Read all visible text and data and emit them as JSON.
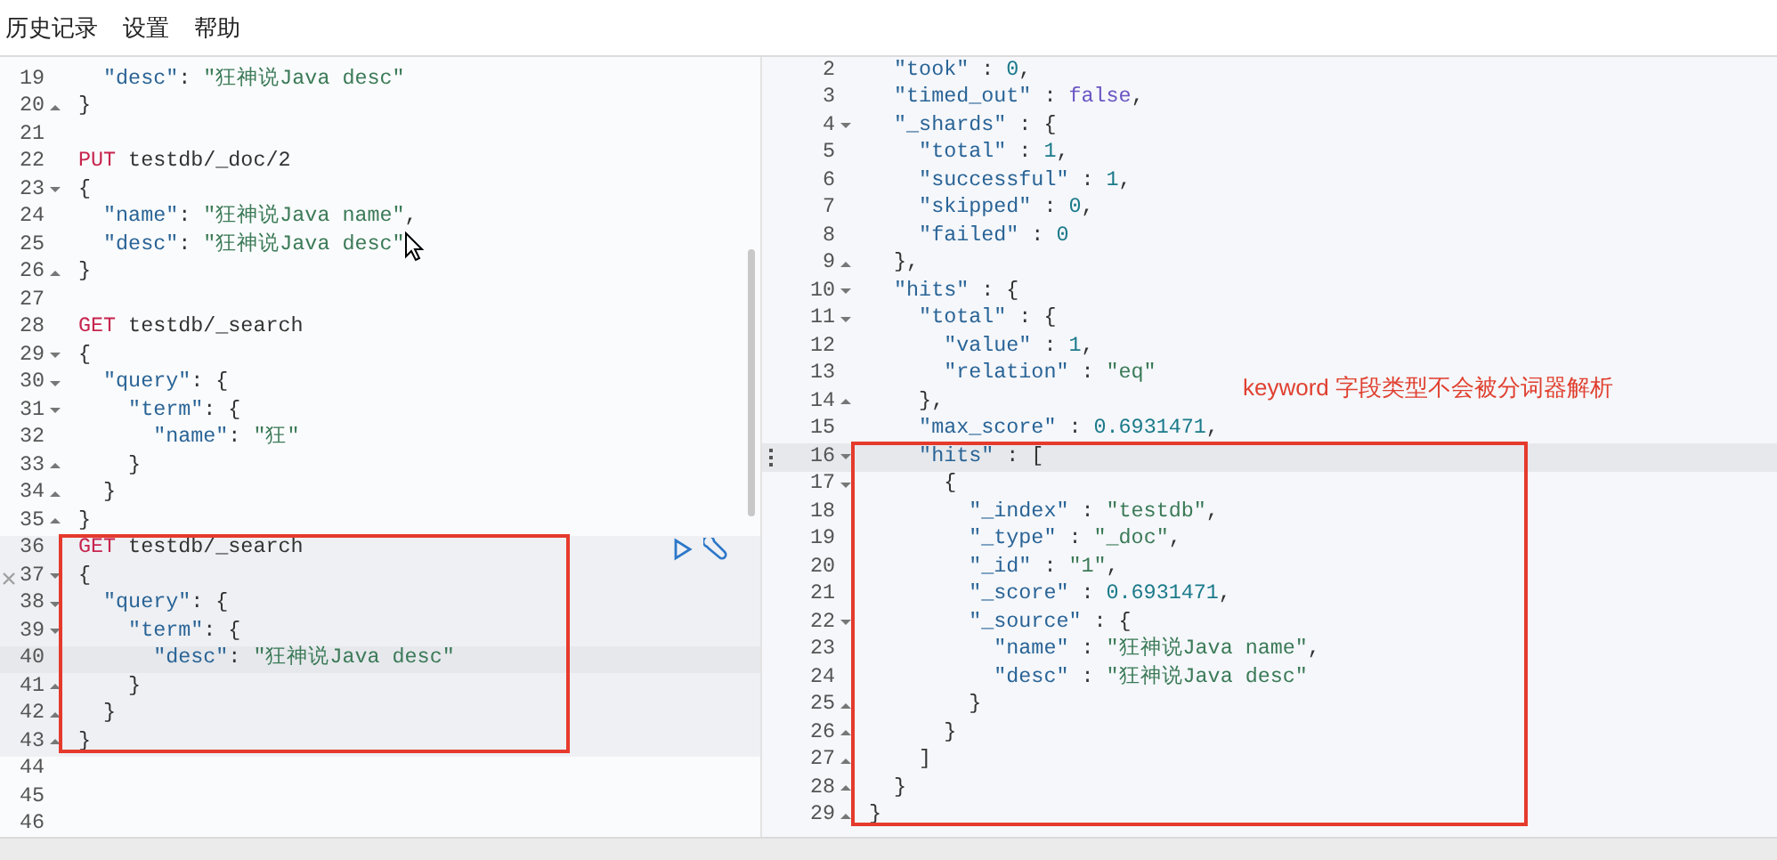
{
  "menu": [
    {
      "label": "历史记录"
    },
    {
      "label": "设置"
    },
    {
      "label": "帮助"
    }
  ],
  "left": {
    "lines": [
      {
        "num": "19",
        "fold_start": false,
        "fold_end": false,
        "active": false,
        "in_block": false,
        "boxed": false,
        "tokens": [
          {
            "kind": "key",
            "text": "  \"desc\""
          },
          {
            "kind": "punct",
            "text": ": "
          },
          {
            "kind": "string",
            "text": "\"狂神说Java desc\""
          }
        ]
      },
      {
        "num": "20",
        "fold_start": false,
        "fold_end": true,
        "active": false,
        "in_block": false,
        "boxed": false,
        "tokens": [
          {
            "kind": "punct",
            "text": "}"
          }
        ]
      },
      {
        "num": "21",
        "fold_start": false,
        "fold_end": false,
        "active": false,
        "in_block": false,
        "boxed": false
      },
      {
        "num": "22",
        "fold_start": false,
        "fold_end": false,
        "active": false,
        "in_block": false,
        "boxed": false,
        "tokens": [
          {
            "kind": "method",
            "text": "PUT"
          },
          {
            "kind": "url",
            "text": " testdb/_doc/2"
          }
        ]
      },
      {
        "num": "23",
        "fold_start": true,
        "fold_end": false,
        "active": false,
        "in_block": false,
        "boxed": false,
        "tokens": [
          {
            "kind": "punct",
            "text": "{"
          }
        ]
      },
      {
        "num": "24",
        "fold_start": false,
        "fold_end": false,
        "active": false,
        "in_block": false,
        "boxed": false,
        "tokens": [
          {
            "kind": "key",
            "text": "  \"name\""
          },
          {
            "kind": "punct",
            "text": ": "
          },
          {
            "kind": "string",
            "text": "\"狂神说Java name\""
          },
          {
            "kind": "punct",
            "text": ","
          }
        ]
      },
      {
        "num": "25",
        "fold_start": false,
        "fold_end": false,
        "active": false,
        "in_block": false,
        "boxed": false,
        "tokens": [
          {
            "kind": "key",
            "text": "  \"desc\""
          },
          {
            "kind": "punct",
            "text": ": "
          },
          {
            "kind": "string",
            "text": "\"狂神说Java desc\""
          }
        ]
      },
      {
        "num": "26",
        "fold_start": false,
        "fold_end": true,
        "active": false,
        "in_block": false,
        "boxed": false,
        "tokens": [
          {
            "kind": "punct",
            "text": "}"
          }
        ]
      },
      {
        "num": "27",
        "fold_start": false,
        "fold_end": false,
        "active": false,
        "in_block": false,
        "boxed": false
      },
      {
        "num": "28",
        "fold_start": false,
        "fold_end": false,
        "active": false,
        "in_block": false,
        "boxed": false,
        "tokens": [
          {
            "kind": "method",
            "text": "GET"
          },
          {
            "kind": "url",
            "text": " testdb/_search"
          }
        ]
      },
      {
        "num": "29",
        "fold_start": true,
        "fold_end": false,
        "active": false,
        "in_block": false,
        "boxed": false,
        "tokens": [
          {
            "kind": "punct",
            "text": "{"
          }
        ]
      },
      {
        "num": "30",
        "fold_start": true,
        "fold_end": false,
        "active": false,
        "in_block": false,
        "boxed": false,
        "tokens": [
          {
            "kind": "key",
            "text": "  \"query\""
          },
          {
            "kind": "punct",
            "text": ": {"
          }
        ]
      },
      {
        "num": "31",
        "fold_start": true,
        "fold_end": false,
        "active": false,
        "in_block": false,
        "boxed": false,
        "tokens": [
          {
            "kind": "key",
            "text": "    \"term\""
          },
          {
            "kind": "punct",
            "text": ": {"
          }
        ]
      },
      {
        "num": "32",
        "fold_start": false,
        "fold_end": false,
        "active": false,
        "in_block": false,
        "boxed": false,
        "tokens": [
          {
            "kind": "key",
            "text": "      \"name\""
          },
          {
            "kind": "punct",
            "text": ": "
          },
          {
            "kind": "string",
            "text": "\"狂\""
          }
        ]
      },
      {
        "num": "33",
        "fold_start": false,
        "fold_end": true,
        "active": false,
        "in_block": false,
        "boxed": false,
        "tokens": [
          {
            "kind": "punct",
            "text": "    }"
          }
        ]
      },
      {
        "num": "34",
        "fold_start": false,
        "fold_end": true,
        "active": false,
        "in_block": false,
        "boxed": false,
        "tokens": [
          {
            "kind": "punct",
            "text": "  }"
          }
        ]
      },
      {
        "num": "35",
        "fold_start": false,
        "fold_end": true,
        "active": false,
        "in_block": false,
        "boxed": false,
        "tokens": [
          {
            "kind": "punct",
            "text": "}"
          }
        ]
      },
      {
        "num": "36",
        "fold_start": false,
        "fold_end": false,
        "active": false,
        "in_block": true,
        "boxed": true,
        "tokens": [
          {
            "kind": "method",
            "text": "GET"
          },
          {
            "kind": "url",
            "text": " testdb/_search"
          }
        ]
      },
      {
        "num": "37",
        "fold_start": true,
        "fold_end": false,
        "active": false,
        "in_block": true,
        "boxed": true,
        "tokens": [
          {
            "kind": "punct",
            "text": "{"
          }
        ]
      },
      {
        "num": "38",
        "fold_start": true,
        "fold_end": false,
        "active": false,
        "in_block": true,
        "boxed": true,
        "tokens": [
          {
            "kind": "key",
            "text": "  \"query\""
          },
          {
            "kind": "punct",
            "text": ": {"
          }
        ]
      },
      {
        "num": "39",
        "fold_start": true,
        "fold_end": false,
        "active": false,
        "in_block": true,
        "boxed": true,
        "tokens": [
          {
            "kind": "key",
            "text": "    \"term\""
          },
          {
            "kind": "punct",
            "text": ": {"
          }
        ]
      },
      {
        "num": "40",
        "fold_start": false,
        "fold_end": false,
        "active": true,
        "in_block": true,
        "boxed": true,
        "tokens": [
          {
            "kind": "key",
            "text": "      \"desc\""
          },
          {
            "kind": "punct",
            "text": ": "
          },
          {
            "kind": "string",
            "text": "\"狂神说Java desc\""
          }
        ]
      },
      {
        "num": "41",
        "fold_start": false,
        "fold_end": true,
        "active": false,
        "in_block": true,
        "boxed": true,
        "tokens": [
          {
            "kind": "punct",
            "text": "    }"
          }
        ]
      },
      {
        "num": "42",
        "fold_start": false,
        "fold_end": true,
        "active": false,
        "in_block": true,
        "boxed": true,
        "tokens": [
          {
            "kind": "punct",
            "text": "  }"
          }
        ]
      },
      {
        "num": "43",
        "fold_start": false,
        "fold_end": true,
        "active": false,
        "in_block": true,
        "boxed": true,
        "tokens": [
          {
            "kind": "punct",
            "text": "}"
          }
        ]
      },
      {
        "num": "44",
        "fold_start": false,
        "fold_end": false,
        "active": false,
        "in_block": false,
        "boxed": false
      },
      {
        "num": "45",
        "fold_start": false,
        "fold_end": false,
        "active": false,
        "in_block": false,
        "boxed": false
      },
      {
        "num": "46",
        "fold_start": false,
        "fold_end": false,
        "active": false,
        "in_block": false,
        "boxed": false
      }
    ]
  },
  "right": {
    "lines": [
      {
        "num": "2",
        "fold_start": false,
        "fold_end": false,
        "active": false,
        "boxed": false,
        "tokens": [
          {
            "kind": "key",
            "text": "  \"took\""
          },
          {
            "kind": "punct",
            "text": " : "
          },
          {
            "kind": "number",
            "text": "0"
          },
          {
            "kind": "punct",
            "text": ","
          }
        ]
      },
      {
        "num": "3",
        "fold_start": false,
        "fold_end": false,
        "active": false,
        "boxed": false,
        "tokens": [
          {
            "kind": "key",
            "text": "  \"timed_out\""
          },
          {
            "kind": "punct",
            "text": " : "
          },
          {
            "kind": "bool",
            "text": "false"
          },
          {
            "kind": "punct",
            "text": ","
          }
        ]
      },
      {
        "num": "4",
        "fold_start": true,
        "fold_end": false,
        "active": false,
        "boxed": false,
        "tokens": [
          {
            "kind": "key",
            "text": "  \"_shards\""
          },
          {
            "kind": "punct",
            "text": " : {"
          }
        ]
      },
      {
        "num": "5",
        "fold_start": false,
        "fold_end": false,
        "active": false,
        "boxed": false,
        "tokens": [
          {
            "kind": "key",
            "text": "    \"total\""
          },
          {
            "kind": "punct",
            "text": " : "
          },
          {
            "kind": "number",
            "text": "1"
          },
          {
            "kind": "punct",
            "text": ","
          }
        ]
      },
      {
        "num": "6",
        "fold_start": false,
        "fold_end": false,
        "active": false,
        "boxed": false,
        "tokens": [
          {
            "kind": "key",
            "text": "    \"successful\""
          },
          {
            "kind": "punct",
            "text": " : "
          },
          {
            "kind": "number",
            "text": "1"
          },
          {
            "kind": "punct",
            "text": ","
          }
        ]
      },
      {
        "num": "7",
        "fold_start": false,
        "fold_end": false,
        "active": false,
        "boxed": false,
        "tokens": [
          {
            "kind": "key",
            "text": "    \"skipped\""
          },
          {
            "kind": "punct",
            "text": " : "
          },
          {
            "kind": "number",
            "text": "0"
          },
          {
            "kind": "punct",
            "text": ","
          }
        ]
      },
      {
        "num": "8",
        "fold_start": false,
        "fold_end": false,
        "active": false,
        "boxed": false,
        "tokens": [
          {
            "kind": "key",
            "text": "    \"failed\""
          },
          {
            "kind": "punct",
            "text": " : "
          },
          {
            "kind": "number",
            "text": "0"
          }
        ]
      },
      {
        "num": "9",
        "fold_start": false,
        "fold_end": true,
        "active": false,
        "boxed": false,
        "tokens": [
          {
            "kind": "punct",
            "text": "  },"
          }
        ]
      },
      {
        "num": "10",
        "fold_start": true,
        "fold_end": false,
        "active": false,
        "boxed": false,
        "tokens": [
          {
            "kind": "key",
            "text": "  \"hits\""
          },
          {
            "kind": "punct",
            "text": " : {"
          }
        ]
      },
      {
        "num": "11",
        "fold_start": true,
        "fold_end": false,
        "active": false,
        "boxed": false,
        "tokens": [
          {
            "kind": "key",
            "text": "    \"total\""
          },
          {
            "kind": "punct",
            "text": " : {"
          }
        ]
      },
      {
        "num": "12",
        "fold_start": false,
        "fold_end": false,
        "active": false,
        "boxed": false,
        "tokens": [
          {
            "kind": "key",
            "text": "      \"value\""
          },
          {
            "kind": "punct",
            "text": " : "
          },
          {
            "kind": "number",
            "text": "1"
          },
          {
            "kind": "punct",
            "text": ","
          }
        ]
      },
      {
        "num": "13",
        "fold_start": false,
        "fold_end": false,
        "active": false,
        "boxed": false,
        "tokens": [
          {
            "kind": "key",
            "text": "      \"relation\""
          },
          {
            "kind": "punct",
            "text": " : "
          },
          {
            "kind": "string",
            "text": "\"eq\""
          }
        ]
      },
      {
        "num": "14",
        "fold_start": false,
        "fold_end": true,
        "active": false,
        "boxed": false,
        "tokens": [
          {
            "kind": "punct",
            "text": "    },"
          }
        ]
      },
      {
        "num": "15",
        "fold_start": false,
        "fold_end": false,
        "active": false,
        "boxed": false,
        "tokens": [
          {
            "kind": "key",
            "text": "    \"max_score\""
          },
          {
            "kind": "punct",
            "text": " : "
          },
          {
            "kind": "number",
            "text": "0.6931471"
          },
          {
            "kind": "punct",
            "text": ","
          }
        ]
      },
      {
        "num": "16",
        "fold_start": true,
        "fold_end": false,
        "active": true,
        "boxed": true,
        "tokens": [
          {
            "kind": "key",
            "text": "    \"hits\""
          },
          {
            "kind": "punct",
            "text": " : ["
          }
        ]
      },
      {
        "num": "17",
        "fold_start": true,
        "fold_end": false,
        "active": false,
        "boxed": true,
        "tokens": [
          {
            "kind": "punct",
            "text": "      {"
          }
        ]
      },
      {
        "num": "18",
        "fold_start": false,
        "fold_end": false,
        "active": false,
        "boxed": true,
        "tokens": [
          {
            "kind": "key",
            "text": "        \"_index\""
          },
          {
            "kind": "punct",
            "text": " : "
          },
          {
            "kind": "string",
            "text": "\"testdb\""
          },
          {
            "kind": "punct",
            "text": ","
          }
        ]
      },
      {
        "num": "19",
        "fold_start": false,
        "fold_end": false,
        "active": false,
        "boxed": true,
        "tokens": [
          {
            "kind": "key",
            "text": "        \"_type\""
          },
          {
            "kind": "punct",
            "text": " : "
          },
          {
            "kind": "string",
            "text": "\"_doc\""
          },
          {
            "kind": "punct",
            "text": ","
          }
        ]
      },
      {
        "num": "20",
        "fold_start": false,
        "fold_end": false,
        "active": false,
        "boxed": true,
        "tokens": [
          {
            "kind": "key",
            "text": "        \"_id\""
          },
          {
            "kind": "punct",
            "text": " : "
          },
          {
            "kind": "string",
            "text": "\"1\""
          },
          {
            "kind": "punct",
            "text": ","
          }
        ]
      },
      {
        "num": "21",
        "fold_start": false,
        "fold_end": false,
        "active": false,
        "boxed": true,
        "tokens": [
          {
            "kind": "key",
            "text": "        \"_score\""
          },
          {
            "kind": "punct",
            "text": " : "
          },
          {
            "kind": "number",
            "text": "0.6931471"
          },
          {
            "kind": "punct",
            "text": ","
          }
        ]
      },
      {
        "num": "22",
        "fold_start": true,
        "fold_end": false,
        "active": false,
        "boxed": true,
        "tokens": [
          {
            "kind": "key",
            "text": "        \"_source\""
          },
          {
            "kind": "punct",
            "text": " : {"
          }
        ]
      },
      {
        "num": "23",
        "fold_start": false,
        "fold_end": false,
        "active": false,
        "boxed": true,
        "tokens": [
          {
            "kind": "key",
            "text": "          \"name\""
          },
          {
            "kind": "punct",
            "text": " : "
          },
          {
            "kind": "string",
            "text": "\"狂神说Java name\""
          },
          {
            "kind": "punct",
            "text": ","
          }
        ]
      },
      {
        "num": "24",
        "fold_start": false,
        "fold_end": false,
        "active": false,
        "boxed": true,
        "tokens": [
          {
            "kind": "key",
            "text": "          \"desc\""
          },
          {
            "kind": "punct",
            "text": " : "
          },
          {
            "kind": "string",
            "text": "\"狂神说Java desc\""
          }
        ]
      },
      {
        "num": "25",
        "fold_start": false,
        "fold_end": true,
        "active": false,
        "boxed": true,
        "tokens": [
          {
            "kind": "punct",
            "text": "        }"
          }
        ]
      },
      {
        "num": "26",
        "fold_start": false,
        "fold_end": true,
        "active": false,
        "boxed": true,
        "tokens": [
          {
            "kind": "punct",
            "text": "      }"
          }
        ]
      },
      {
        "num": "27",
        "fold_start": false,
        "fold_end": true,
        "active": false,
        "boxed": true,
        "tokens": [
          {
            "kind": "punct",
            "text": "    ]"
          }
        ]
      },
      {
        "num": "28",
        "fold_start": false,
        "fold_end": true,
        "active": false,
        "boxed": true,
        "tokens": [
          {
            "kind": "punct",
            "text": "  }"
          }
        ]
      },
      {
        "num": "29",
        "fold_start": false,
        "fold_end": true,
        "active": false,
        "boxed": true,
        "tokens": [
          {
            "kind": "punct",
            "text": "}"
          }
        ]
      }
    ]
  },
  "annotation": {
    "text": "keyword 字段类型不会被分词器解析"
  }
}
